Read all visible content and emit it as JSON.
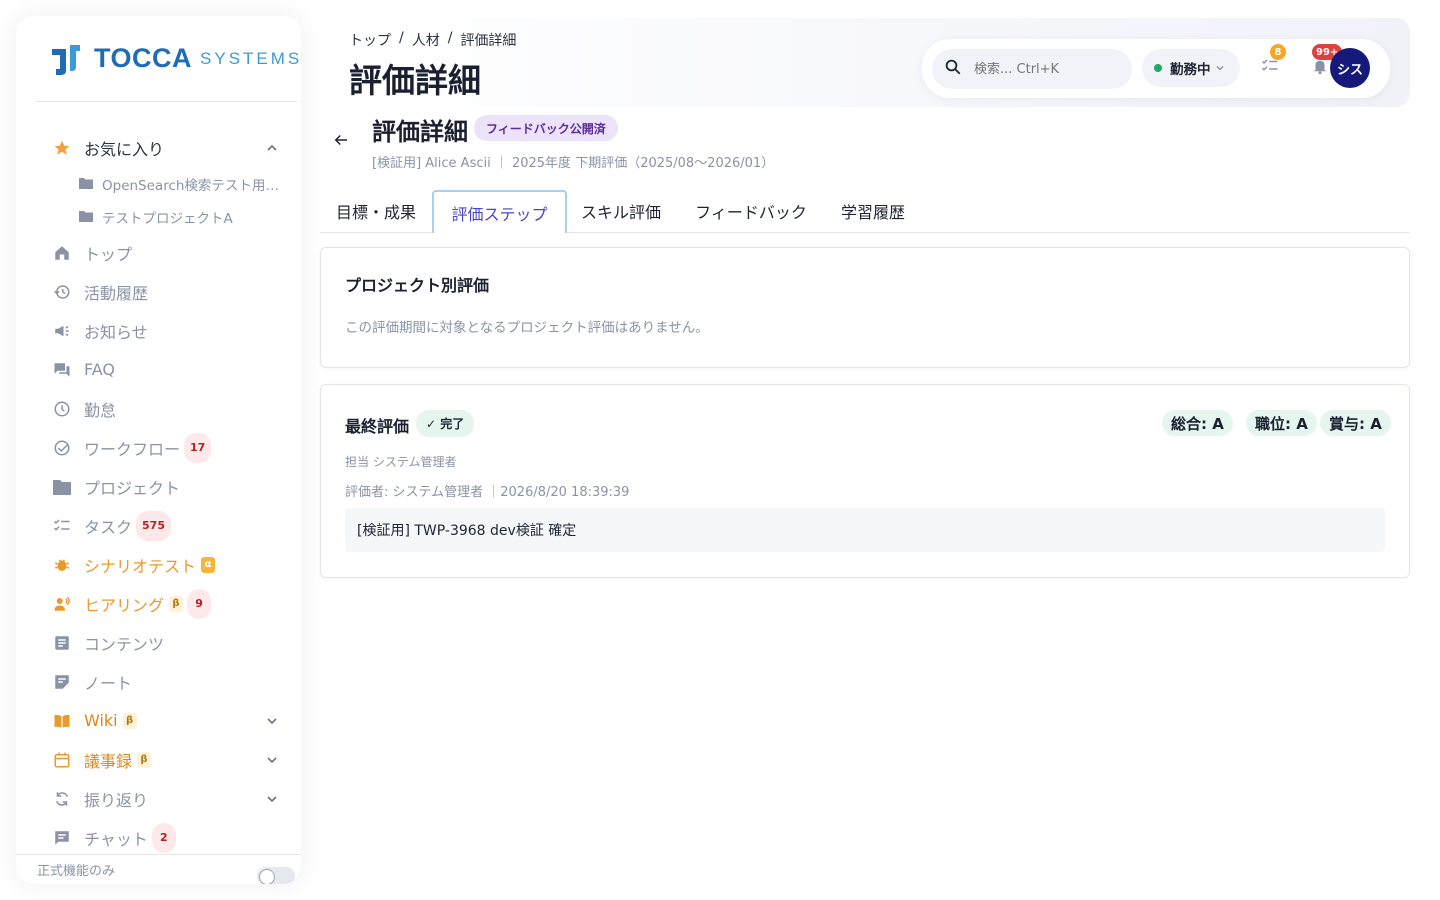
{
  "brand": {
    "name": "TOCCA",
    "suffix": "SYSTEMS"
  },
  "sidebar": {
    "favorites_label": "お気に入り",
    "favorites": [
      {
        "label": "OpenSearch検索テスト用プ..."
      },
      {
        "label": "テストプロジェクトA"
      }
    ],
    "items": [
      {
        "label": "トップ"
      },
      {
        "label": "活動履歴"
      },
      {
        "label": "お知らせ"
      },
      {
        "label": "FAQ"
      },
      {
        "label": "勤怠"
      },
      {
        "label": "ワークフロー",
        "badge": "17"
      },
      {
        "label": "プロジェクト"
      },
      {
        "label": "タスク",
        "badge": "575"
      },
      {
        "label": "シナリオテスト",
        "tag": "α"
      },
      {
        "label": "ヒアリング",
        "tag": "β",
        "badge": "9"
      },
      {
        "label": "コンテンツ"
      },
      {
        "label": "ノート"
      },
      {
        "label": "Wiki",
        "tag": "β"
      },
      {
        "label": "議事録",
        "tag": "β"
      },
      {
        "label": "振り返り"
      },
      {
        "label": "チャット",
        "badge": "2"
      }
    ],
    "footer_label": "正式機能のみ"
  },
  "header": {
    "breadcrumb": [
      "トップ",
      "人材",
      "評価詳細"
    ],
    "breadcrumb_sep": "/",
    "title": "評価詳細",
    "search_placeholder": "検索... Ctrl+K",
    "status_label": "勤務中",
    "tasks_count": "8",
    "notifications_count": "99+",
    "avatar_text": "シス"
  },
  "detail": {
    "title": "評価詳細",
    "status_tag": "フィードバック公開済",
    "meta": "[検証用] Alice Ascii ｜ 2025年度 下期評価（2025/08〜2026/01）"
  },
  "tabs": [
    {
      "label": "目標・成果"
    },
    {
      "label": "評価ステップ",
      "active": true
    },
    {
      "label": "スキル評価"
    },
    {
      "label": "フィードバック"
    },
    {
      "label": "学習履歴"
    }
  ],
  "project_eval": {
    "title": "プロジェクト別評価",
    "empty": "この評価期間に対象となるプロジェクト評価はありません。"
  },
  "final_eval": {
    "title": "最終評価",
    "status": "✓ 完了",
    "grades": [
      "総合: A",
      "職位: A",
      "賞与: A"
    ],
    "assignee": "担当 システム管理者",
    "evaluator": "評価者: システム管理者 ｜2026/8/20 18:39:39",
    "comment": "[検証用] TWP-3968 dev検証 確定"
  },
  "colors": {
    "accent": "#4a45c8",
    "brand": "#1f6bb5",
    "avatar": "#151a7a",
    "status_green": "#1fa868"
  }
}
